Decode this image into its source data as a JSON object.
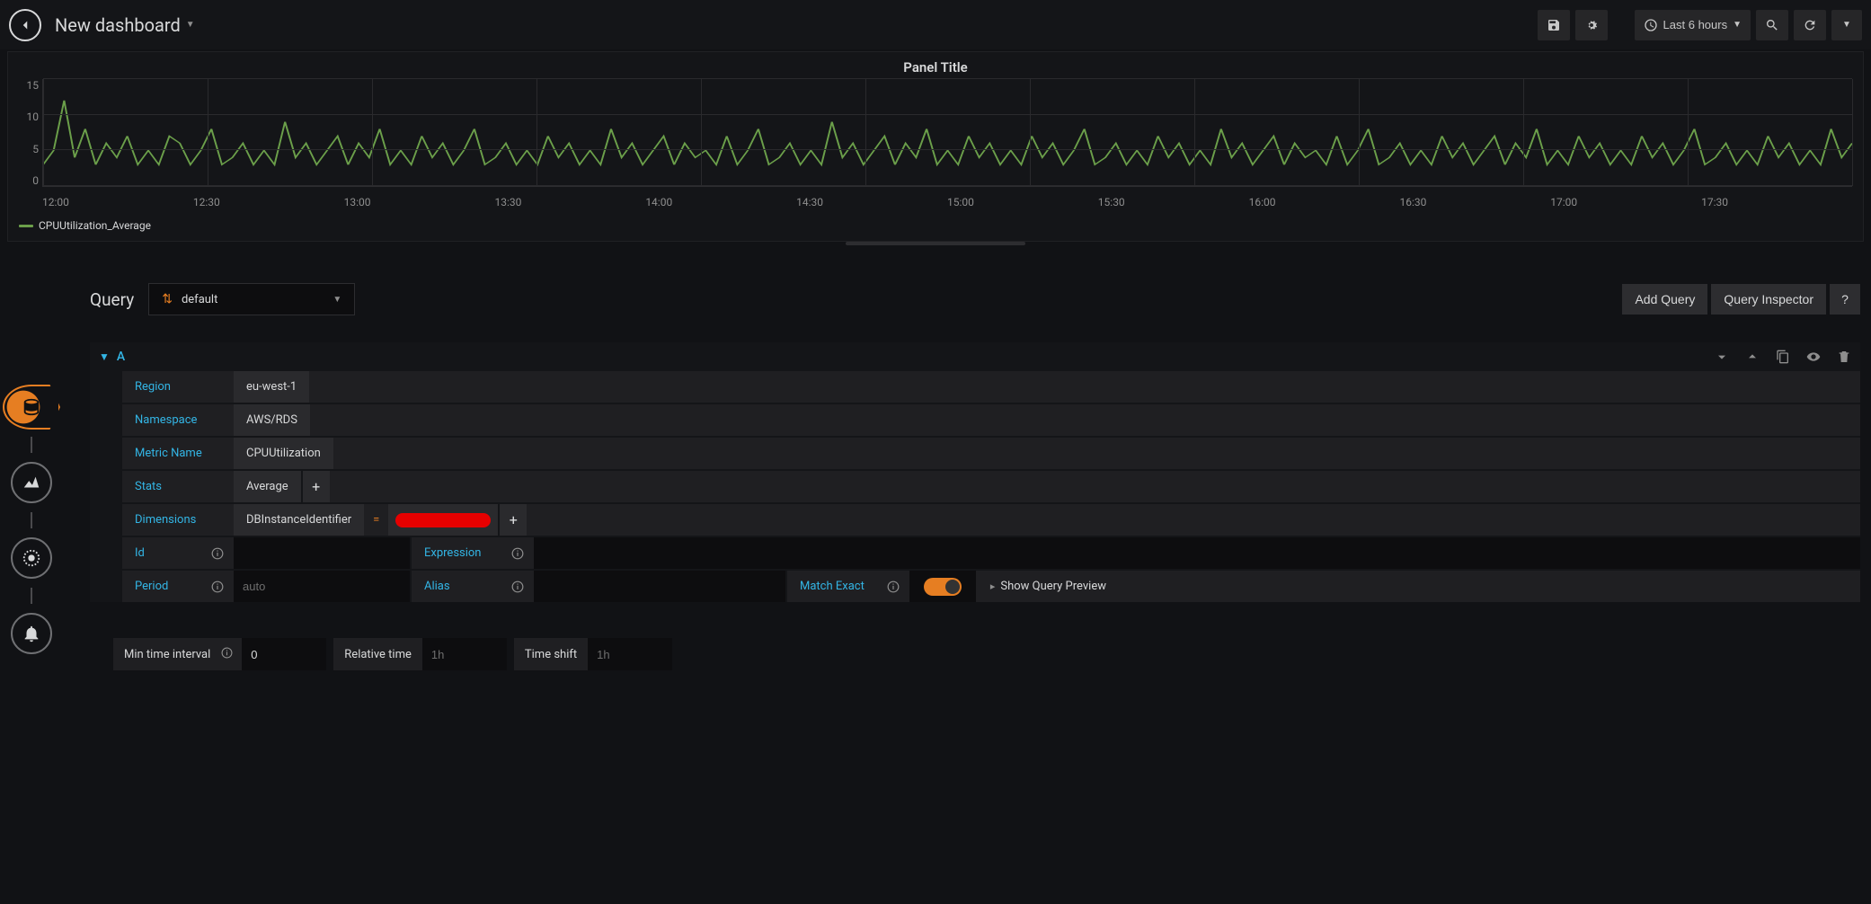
{
  "header": {
    "title": "New dashboard",
    "timerange": "Last 6 hours"
  },
  "panel": {
    "title": "Panel Title",
    "legend": "CPUUtilization_Average"
  },
  "chart_data": {
    "type": "line",
    "title": "Panel Title",
    "xlabel": "",
    "ylabel": "",
    "ylim": [
      0,
      15
    ],
    "y_ticks": [
      0,
      5,
      10,
      15
    ],
    "x_ticks": [
      "12:00",
      "12:30",
      "13:00",
      "13:30",
      "14:00",
      "14:30",
      "15:00",
      "15:30",
      "16:00",
      "16:30",
      "17:00",
      "17:30"
    ],
    "series": [
      {
        "name": "CPUUtilization_Average",
        "x": [
          "12:00",
          "12:02",
          "12:04",
          "12:06",
          "12:08",
          "12:10",
          "12:12",
          "12:14",
          "12:16",
          "12:18",
          "12:20",
          "12:22",
          "12:24",
          "12:26",
          "12:28",
          "12:30",
          "12:32",
          "12:34",
          "12:36",
          "12:38",
          "12:40",
          "12:42",
          "12:44",
          "12:46",
          "12:48",
          "12:50",
          "12:52",
          "12:54",
          "12:56",
          "12:58",
          "13:00",
          "13:02",
          "13:04",
          "13:06",
          "13:08",
          "13:10",
          "13:12",
          "13:14",
          "13:16",
          "13:18",
          "13:20",
          "13:22",
          "13:24",
          "13:26",
          "13:28",
          "13:30",
          "13:32",
          "13:34",
          "13:36",
          "13:38",
          "13:40",
          "13:42",
          "13:44",
          "13:46",
          "13:48",
          "13:50",
          "13:52",
          "13:54",
          "13:56",
          "13:58",
          "14:00",
          "14:02",
          "14:04",
          "14:06",
          "14:08",
          "14:10",
          "14:12",
          "14:14",
          "14:16",
          "14:18",
          "14:20",
          "14:22",
          "14:24",
          "14:26",
          "14:28",
          "14:30",
          "14:32",
          "14:34",
          "14:36",
          "14:38",
          "14:40",
          "14:42",
          "14:44",
          "14:46",
          "14:48",
          "14:50",
          "14:52",
          "14:54",
          "14:56",
          "14:58",
          "15:00",
          "15:02",
          "15:04",
          "15:06",
          "15:08",
          "15:10",
          "15:12",
          "15:14",
          "15:16",
          "15:18",
          "15:20",
          "15:22",
          "15:24",
          "15:26",
          "15:28",
          "15:30",
          "15:32",
          "15:34",
          "15:36",
          "15:38",
          "15:40",
          "15:42",
          "15:44",
          "15:46",
          "15:48",
          "15:50",
          "15:52",
          "15:54",
          "15:56",
          "15:58",
          "16:00",
          "16:02",
          "16:04",
          "16:06",
          "16:08",
          "16:10",
          "16:12",
          "16:14",
          "16:16",
          "16:18",
          "16:20",
          "16:22",
          "16:24",
          "16:26",
          "16:28",
          "16:30",
          "16:32",
          "16:34",
          "16:36",
          "16:38",
          "16:40",
          "16:42",
          "16:44",
          "16:46",
          "16:48",
          "16:50",
          "16:52",
          "16:54",
          "16:56",
          "16:58",
          "17:00",
          "17:02",
          "17:04",
          "17:06",
          "17:08",
          "17:10",
          "17:12",
          "17:14",
          "17:16",
          "17:18",
          "17:20",
          "17:22",
          "17:24",
          "17:26",
          "17:28",
          "17:30",
          "17:32",
          "17:34",
          "17:36",
          "17:38",
          "17:40",
          "17:42",
          "17:44"
        ],
        "values": [
          3,
          5,
          12,
          4,
          8,
          3,
          6,
          4,
          7,
          3,
          5,
          3,
          7,
          6,
          3,
          5,
          8,
          3,
          4,
          6,
          3,
          5,
          3,
          9,
          4,
          6,
          3,
          5,
          7,
          3,
          6,
          4,
          8,
          3,
          5,
          3,
          7,
          4,
          6,
          3,
          5,
          8,
          3,
          4,
          6,
          3,
          5,
          3,
          7,
          4,
          6,
          3,
          5,
          3,
          8,
          4,
          6,
          3,
          5,
          7,
          3,
          6,
          4,
          5,
          3,
          7,
          3,
          5,
          8,
          3,
          4,
          6,
          3,
          5,
          3,
          9,
          4,
          6,
          3,
          5,
          7,
          3,
          6,
          4,
          8,
          3,
          5,
          3,
          7,
          4,
          6,
          3,
          5,
          3,
          7,
          4,
          6,
          3,
          5,
          8,
          3,
          4,
          6,
          3,
          5,
          3,
          7,
          4,
          6,
          3,
          5,
          3,
          8,
          4,
          6,
          3,
          5,
          7,
          3,
          6,
          4,
          5,
          3,
          7,
          3,
          5,
          8,
          3,
          4,
          6,
          3,
          5,
          3,
          7,
          4,
          6,
          3,
          5,
          7,
          3,
          6,
          4,
          8,
          3,
          5,
          3,
          7,
          4,
          6,
          3,
          5,
          3,
          7,
          4,
          6,
          3,
          5,
          8,
          3,
          4,
          6,
          3,
          5,
          3,
          7,
          4,
          6,
          3,
          5,
          3,
          8,
          4,
          6
        ]
      }
    ]
  },
  "query": {
    "section_title": "Query",
    "datasource": "default",
    "add_query": "Add Query",
    "inspector": "Query Inspector",
    "help": "?",
    "letter": "A",
    "labels": {
      "region": "Region",
      "namespace": "Namespace",
      "metric": "Metric Name",
      "stats": "Stats",
      "dimensions": "Dimensions",
      "id": "Id",
      "expression": "Expression",
      "period": "Period",
      "alias": "Alias",
      "match_exact": "Match Exact",
      "show_preview": "Show Query Preview"
    },
    "values": {
      "region": "eu-west-1",
      "namespace": "AWS/RDS",
      "metric": "CPUUtilization",
      "stats": "Average",
      "dim_key": "DBInstanceIdentifier",
      "dim_eq": "=",
      "period_placeholder": "auto"
    }
  },
  "bottom": {
    "min_interval": "Min time interval",
    "min_interval_val": "0",
    "relative_time": "Relative time",
    "relative_ph": "1h",
    "time_shift": "Time shift",
    "time_shift_ph": "1h"
  }
}
